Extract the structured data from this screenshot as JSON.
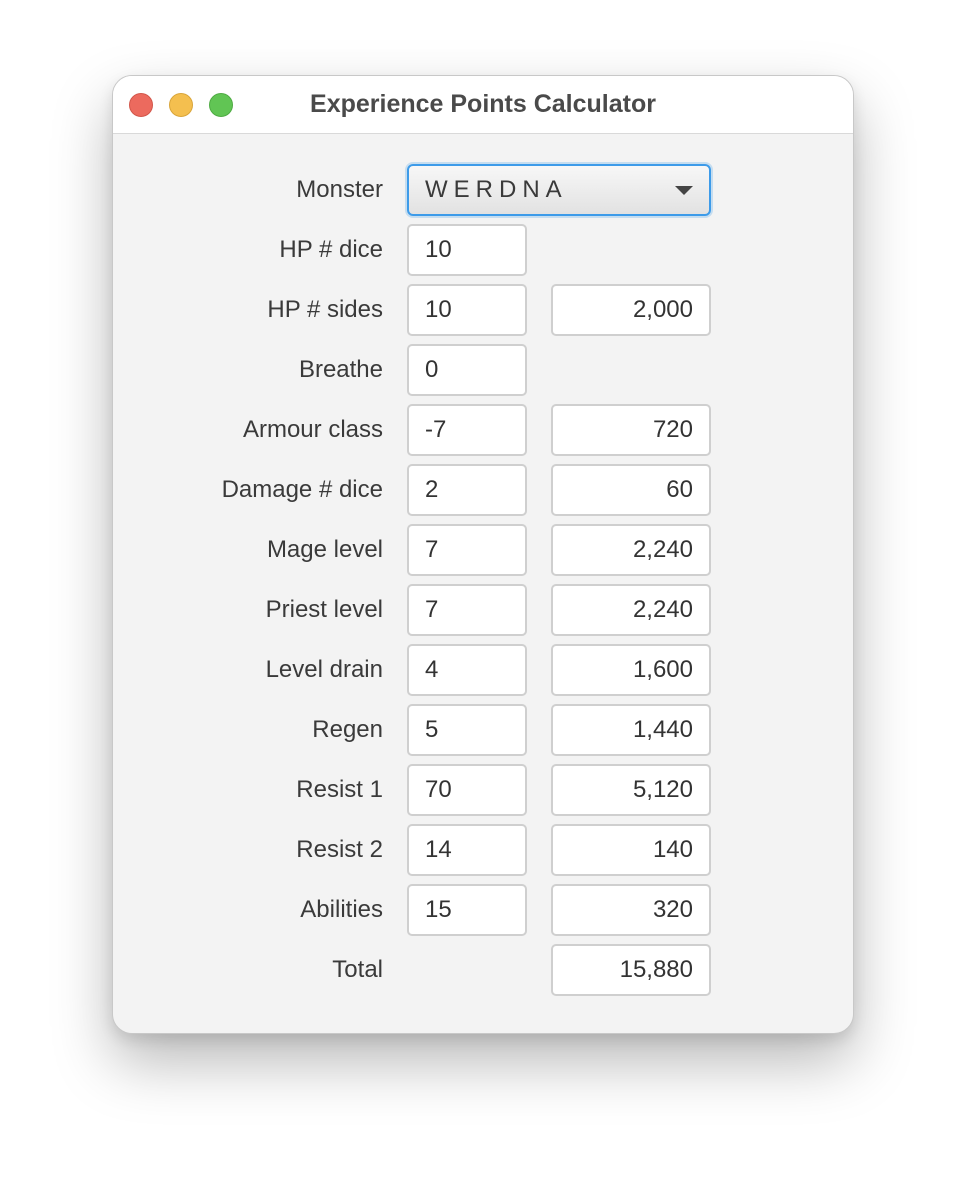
{
  "window": {
    "title": "Experience Points Calculator"
  },
  "monster": {
    "label": "Monster",
    "selected": "WERDNA"
  },
  "rows": [
    {
      "label": "HP # dice",
      "input": "10"
    },
    {
      "label": "HP # sides",
      "input": "10",
      "output": "2,000"
    },
    {
      "label": "Breathe",
      "input": "0"
    },
    {
      "label": "Armour class",
      "input": "-7",
      "output": "720"
    },
    {
      "label": "Damage # dice",
      "input": "2",
      "output": "60"
    },
    {
      "label": "Mage level",
      "input": "7",
      "output": "2,240"
    },
    {
      "label": "Priest level",
      "input": "7",
      "output": "2,240"
    },
    {
      "label": "Level drain",
      "input": "4",
      "output": "1,600"
    },
    {
      "label": "Regen",
      "input": "5",
      "output": "1,440"
    },
    {
      "label": "Resist 1",
      "input": "70",
      "output": "5,120"
    },
    {
      "label": "Resist 2",
      "input": "14",
      "output": "140"
    },
    {
      "label": "Abilities",
      "input": "15",
      "output": "320"
    }
  ],
  "total": {
    "label": "Total",
    "output": "15,880"
  }
}
